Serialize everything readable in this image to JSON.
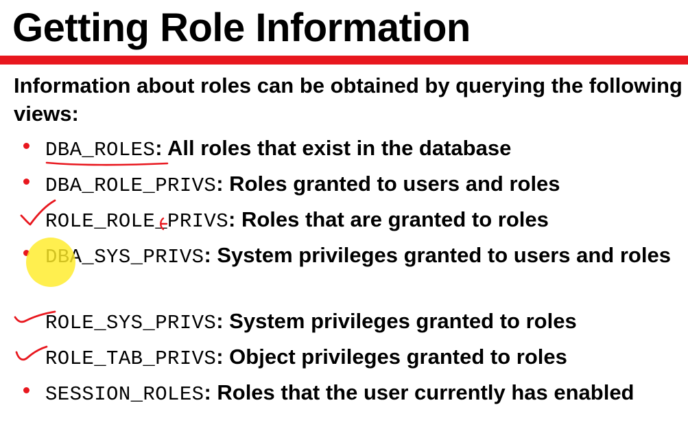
{
  "slide": {
    "title": "Getting Role Information",
    "intro": "Information about roles can be obtained by querying the following views:",
    "accent_color": "#e8171e",
    "annotation_color": "#e8171e",
    "highlight_color": "#ffec28"
  },
  "bullets": [
    {
      "view": "DBA_ROLES",
      "desc": ": All roles that exist in the database"
    },
    {
      "view": "DBA_ROLE_PRIVS",
      "desc": ": Roles granted to users and roles"
    },
    {
      "view": "ROLE_ROLE_PRIVS",
      "desc": ": Roles that are granted to roles"
    },
    {
      "view": "DBA_SYS_PRIVS",
      "desc": ": System privileges granted to users and roles"
    },
    {
      "view": "ROLE_SYS_PRIVS",
      "desc": ": System privileges granted to roles"
    },
    {
      "view": "ROLE_TAB_PRIVS",
      "desc": ": Object privileges granted to roles"
    },
    {
      "view": "SESSION_ROLES",
      "desc": ": Roles that the user currently has enabled"
    }
  ]
}
